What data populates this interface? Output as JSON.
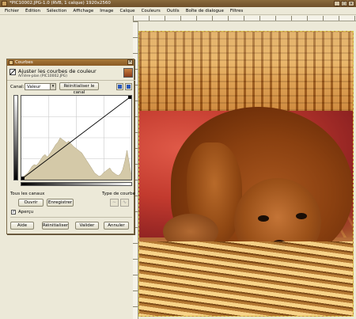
{
  "window": {
    "title": "*PIC10002.JPG-1.0 (RVB, 1 calque) 1920x2560",
    "controls": [
      "_",
      "□",
      "×"
    ]
  },
  "menu": [
    "Fichier",
    "Édition",
    "Sélection",
    "Affichage",
    "Image",
    "Calque",
    "Couleurs",
    "Outils",
    "Boîte de dialogue",
    "Filtres"
  ],
  "dialog": {
    "title": "Courbes",
    "header_title": "Ajuster les courbes de couleur",
    "header_subtitle": "Arrière-plan (PIC10002.JPG)",
    "canal_label": "Canal:",
    "canal_value": "Valeur",
    "reset_channel": "Réinitialiser le canal",
    "all_channels": "Tous les canaux",
    "curve_type": "Type de courbe",
    "open_button": "Ouvrir",
    "save_button": "Enregistrer",
    "preview_label": "Aperçu",
    "preview_checked": true,
    "help_button": "Aide",
    "reset_button": "Réinitialiser",
    "ok_button": "Valider",
    "cancel_button": "Annuler"
  },
  "curve": {
    "histogram": [
      0.02,
      0.04,
      0.06,
      0.08,
      0.12,
      0.16,
      0.18,
      0.17,
      0.2,
      0.24,
      0.28,
      0.3,
      0.27,
      0.3,
      0.34,
      0.38,
      0.42,
      0.45,
      0.5,
      0.48,
      0.46,
      0.44,
      0.46,
      0.43,
      0.4,
      0.38,
      0.36,
      0.34,
      0.32,
      0.28,
      0.24,
      0.2,
      0.16,
      0.12,
      0.08,
      0.06,
      0.04,
      0.05,
      0.08,
      0.1,
      0.12,
      0.14,
      0.1,
      0.08,
      0.06,
      0.05,
      0.07,
      0.12,
      0.22,
      0.35,
      0.2,
      0.06
    ],
    "grid": true
  }
}
